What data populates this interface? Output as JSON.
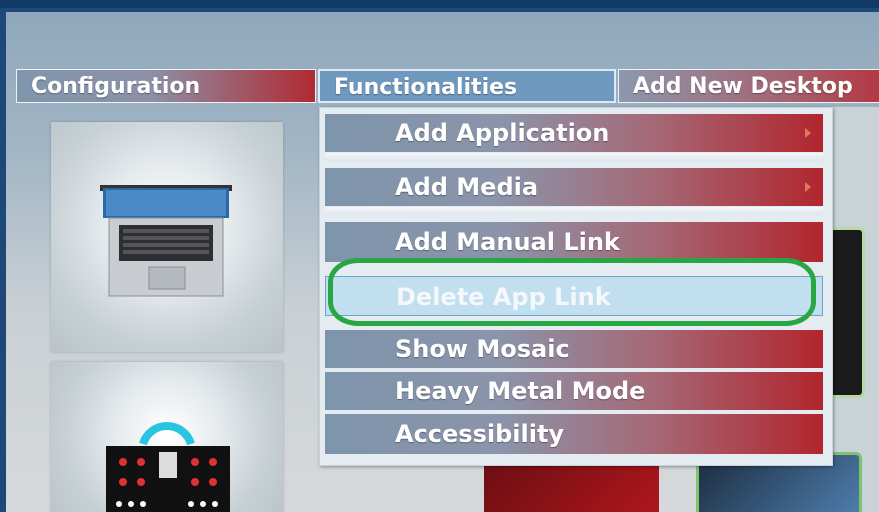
{
  "tabs": {
    "configuration": "Configuration",
    "functionalities": "Functionalities",
    "add_new_desktop": "Add New Desktop"
  },
  "menu": {
    "items": [
      {
        "label": "Add Application",
        "submenu": true
      },
      {
        "label": "Add Media",
        "submenu": true
      },
      {
        "label": "Add Manual Link",
        "submenu": false
      },
      {
        "label": "Delete App Link",
        "submenu": false,
        "hovered": true
      },
      {
        "label": "Show Mosaic",
        "submenu": false
      },
      {
        "label": "Heavy Metal Mode",
        "submenu": false
      },
      {
        "label": "Accessibility",
        "submenu": false
      }
    ]
  },
  "tiles": [
    {
      "icon": "laptop-icon"
    },
    {
      "icon": "music-controller-icon"
    }
  ],
  "colors": {
    "menu_gradient_start": "#7d95ab",
    "menu_gradient_end": "#b1262e",
    "hover_background": "#c2dff0",
    "annotation_ring": "#27a744"
  }
}
